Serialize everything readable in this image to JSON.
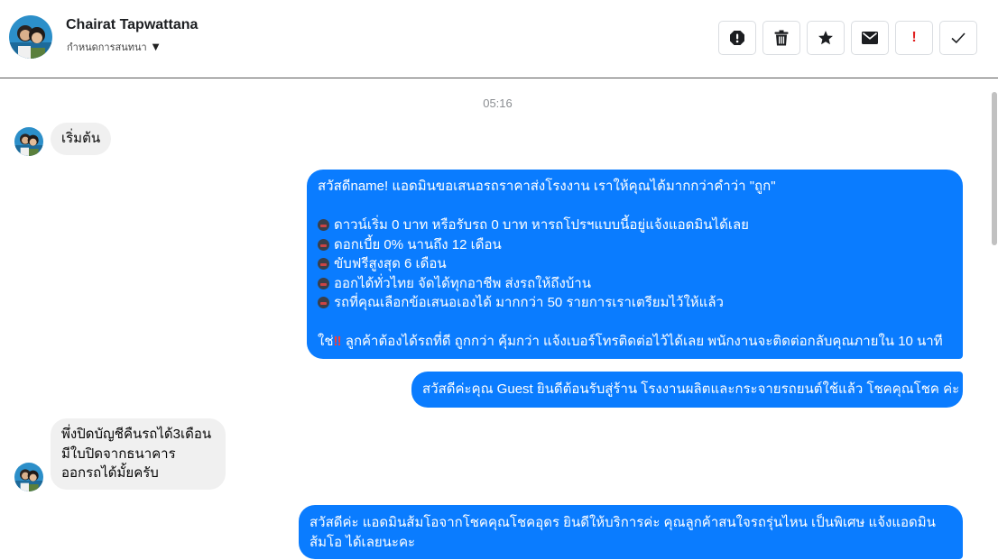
{
  "header": {
    "contact_name": "Chairat Tapwattana",
    "subtitle": "กำหนดการสนทนา",
    "toolbar_icons": [
      "report-icon",
      "trash-icon",
      "star-icon",
      "mail-icon",
      "exclamation-icon",
      "check-icon"
    ],
    "exclamation_label": "!"
  },
  "chat": {
    "timestamp": "05:16",
    "messages": [
      {
        "side": "in",
        "lines": [
          "เริ่มต้น"
        ]
      },
      {
        "side": "out",
        "lines": [
          "สวัสดีname! แอดมินขอเสนอรถราคาส่งโรงงาน เราให้คุณได้มากกว่าคำว่า \"ถูก\"",
          "",
          "ดาวน์เริ่ม 0 บาท หรือรับรถ 0 บาท หารถโปรฯแบบนี้อยู่แจ้งแอดมินได้เลย",
          "ดอกเบี้ย 0% นานถึง 12 เดือน",
          "ขับฟรีสูงสุด 6 เดือน",
          "ออกได้ทั่วไทย จัดได้ทุกอาชีพ ส่งรถให้ถึงบ้าน",
          "รถที่คุณเลือกข้อเสนอเองได้ มากกว่า 50 รายการเราเตรียมไว้ให้แล้ว",
          "",
          "ใช่",
          "ลูกค้าต้องได้รถที่ดี ถูกกว่า คุ้มกว่า แจ้งเบอร์โทรติดต่อไว้ได้เลย พนักงานจะติดต่อกลับคุณภายใน 10 นาที"
        ],
        "bang": "‼"
      },
      {
        "side": "out",
        "lines": [
          "สวัสดีค่ะคุณ Guest ยินดีต้อนรับสู่ร้าน โรงงานผลิตและกระจายรถยนต์ใช้แล้ว โชคคุณโชค ค่ะ"
        ]
      },
      {
        "side": "in",
        "lines": [
          "พึ่งปิดบัญชีคืนรถได้3เดือน",
          "มีใบปิดจากธนาคาร",
          "ออกรถได้มั้ยครับ"
        ]
      },
      {
        "side": "out",
        "lines": [
          "สวัสดีค่ะ แอดมินส้มโอจากโชคคุณโชคอุดร ยินดีให้บริการค่ะ   คุณลูกค้าสนใจรถรุ่นไหน เป็นพิเศษ แจ้งแอดมิน",
          "ส้มโอ ได้เลยนะคะ"
        ]
      }
    ]
  },
  "colors": {
    "outgoing_bubble": "#0a7cff",
    "incoming_bubble": "#f0f0f0",
    "alert_red": "#e02020"
  }
}
